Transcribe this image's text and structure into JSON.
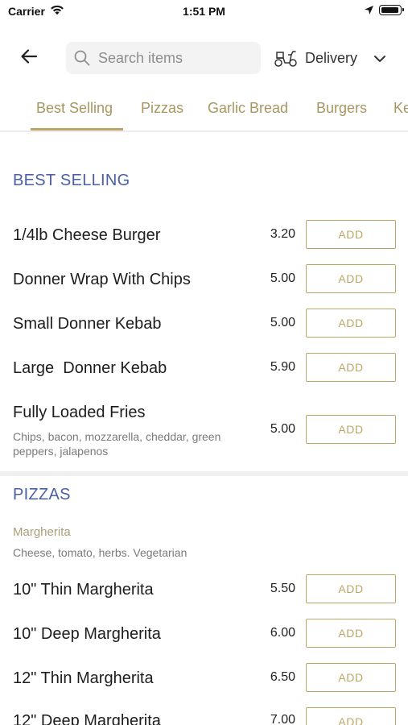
{
  "status_bar": {
    "carrier": "Carrier",
    "time": "1:51 PM"
  },
  "header": {
    "search_placeholder": "Search items",
    "delivery_label": "Delivery"
  },
  "tabs": [
    {
      "label": "Best Selling",
      "active": true
    },
    {
      "label": "Pizzas"
    },
    {
      "label": "Garlic Bread"
    },
    {
      "label": "Burgers"
    },
    {
      "label": "Ke"
    }
  ],
  "sections": [
    {
      "title": "BEST SELLING",
      "items": [
        {
          "name": "1/4lb Cheese Burger",
          "price": "3.20",
          "button": "ADD"
        },
        {
          "name": "Donner Wrap With Chips",
          "price": "5.00",
          "button": "ADD"
        },
        {
          "name": "Small Donner Kebab",
          "price": "5.00",
          "button": "ADD"
        },
        {
          "name": "Large  Donner Kebab",
          "price": "5.90",
          "button": "ADD"
        },
        {
          "name": "Fully Loaded Fries",
          "description": "Chips, bacon, mozzarella, cheddar, green peppers, jalapenos",
          "price": "5.00",
          "button": "ADD"
        }
      ]
    },
    {
      "title": "PIZZAS",
      "subcategory": "Margherita",
      "subcategory_description": "Cheese, tomato, herbs. Vegetarian",
      "items": [
        {
          "name": "10\" Thin Margherita",
          "price": "5.50",
          "button": "ADD"
        },
        {
          "name": "10\" Deep Margherita",
          "price": "6.00",
          "button": "ADD"
        },
        {
          "name": "12\" Thin Margherita",
          "price": "6.50",
          "button": "ADD"
        },
        {
          "name": "12\" Deep Margherita",
          "price": "7.00",
          "button": "ADD"
        }
      ]
    }
  ],
  "icons": {
    "back": "arrow-left-icon",
    "search": "search-icon",
    "delivery": "scooter-icon",
    "dropdown": "chevron-down-icon",
    "wifi": "wifi-icon",
    "location": "location-arrow-icon",
    "battery": "battery-icon"
  },
  "colors": {
    "accent_gold": "#bda766",
    "section_title_blue": "#4b5fa3",
    "subcategory_tan": "#ab9e78",
    "divider_grey": "#f0f0f0"
  }
}
